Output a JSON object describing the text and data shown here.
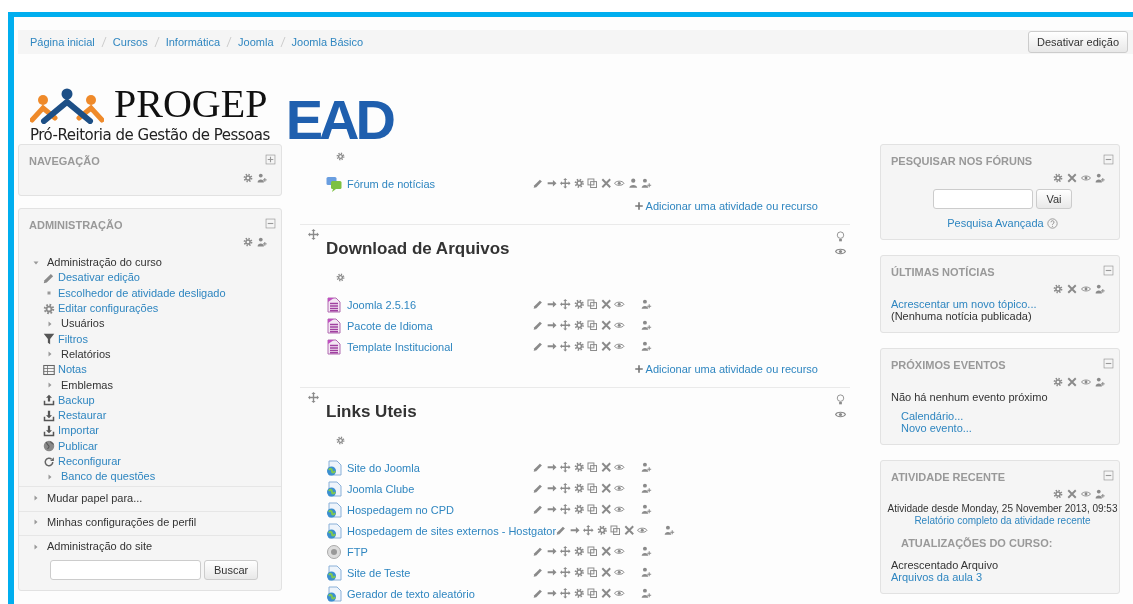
{
  "breadcrumb": [
    "Página inicial",
    "Cursos",
    "Informática",
    "Joomla",
    "Joomla Básico"
  ],
  "edit_button": "Desativar edição",
  "logo": {
    "name": "PROGEP",
    "subtitle": "Pró-Reitoria de Gestão de Pessoas",
    "tag": "EAD"
  },
  "left_blocks": [
    {
      "kind": "navigation",
      "title": "NAVEGAÇÃO",
      "expanded": false,
      "deletable": false
    },
    {
      "kind": "tree",
      "title": "ADMINISTRAÇÃO",
      "expanded": true,
      "deletable": false,
      "button": "Buscar",
      "tree": [
        {
          "kind": "branch",
          "label": "Administração do curso",
          "expanded": true,
          "children": [
            {
              "kind": "link",
              "label": "Desativar edição"
            },
            {
              "kind": "link",
              "label": "Escolhedor de atividade desligado"
            },
            {
              "kind": "link",
              "label": "Editar configurações"
            },
            {
              "kind": "branch",
              "label": "Usuários",
              "expanded": false
            },
            {
              "kind": "link",
              "label": "Filtros"
            },
            {
              "kind": "branch",
              "label": "Relatórios",
              "expanded": false
            },
            {
              "kind": "link",
              "label": "Notas"
            },
            {
              "kind": "branch",
              "label": "Emblemas",
              "expanded": false
            },
            {
              "kind": "link",
              "label": "Backup"
            },
            {
              "kind": "link",
              "label": "Restaurar"
            },
            {
              "kind": "link",
              "label": "Importar"
            },
            {
              "kind": "link",
              "label": "Publicar"
            },
            {
              "kind": "link",
              "label": "Reconfigurar"
            },
            {
              "kind": "branch-link",
              "label": "Banco de questões",
              "expanded": false
            }
          ]
        },
        {
          "kind": "branch",
          "label": "Mudar papel para...",
          "expanded": false
        },
        {
          "kind": "branch",
          "label": "Minhas configurações de perfil",
          "expanded": false
        },
        {
          "kind": "branch",
          "label": "Administração do site",
          "expanded": false
        }
      ]
    }
  ],
  "sections": [
    {
      "activities": [
        {
          "kind": "forum",
          "name": "Fórum de notícias",
          "groups_icon": true
        }
      ],
      "add_link": "Adicionar uma atividade ou recurso"
    },
    {
      "title": "Download de Arquivos",
      "activities": [
        {
          "kind": "file",
          "name": "Joomla 2.5.16",
          "groups_icon": false
        },
        {
          "kind": "file",
          "name": "Pacote de Idioma",
          "groups_icon": false
        },
        {
          "kind": "file",
          "name": "Template Institucional",
          "groups_icon": false
        }
      ],
      "add_link": "Adicionar uma atividade ou recurso"
    },
    {
      "title": "Links Uteis",
      "activities": [
        {
          "kind": "url",
          "name": "Site do Joomla",
          "groups_icon": false
        },
        {
          "kind": "url",
          "name": "Joomla Clube",
          "groups_icon": false
        },
        {
          "kind": "url",
          "name": "Hospedagem no CPD",
          "groups_icon": false
        },
        {
          "kind": "url",
          "name": "Hospedagem de sites externos - Hostgator",
          "groups_icon": false
        },
        {
          "kind": "ftp",
          "name": "FTP",
          "groups_icon": false
        },
        {
          "kind": "url",
          "name": "Site de Teste",
          "groups_icon": false
        },
        {
          "kind": "url",
          "name": "Gerador de texto aleatório",
          "groups_icon": false
        }
      ]
    }
  ],
  "right_blocks": [
    {
      "kind": "search",
      "title": "PESQUISAR NOS FÓRUNS",
      "expanded": true,
      "deletable": true,
      "button": "Vai",
      "link": "Pesquisa Avançada"
    },
    {
      "kind": "news",
      "title": "ÚLTIMAS NOTÍCIAS",
      "expanded": true,
      "deletable": true,
      "link": "Acrescentar um novo tópico...",
      "note": "(Nenhuma notícia publicada)"
    },
    {
      "kind": "events",
      "title": "PRÓXIMOS EVENTOS",
      "expanded": true,
      "deletable": true,
      "note": "Não há nenhum evento próximo",
      "links": [
        "Calendário...",
        "Novo evento..."
      ]
    },
    {
      "kind": "recent",
      "title": "ATIVIDADE RECENTE",
      "expanded": true,
      "deletable": true,
      "since": "Atividade desde Monday, 25 November 2013, 09:53",
      "link": "Relatório completo da atividade recente",
      "subheading": "ATUALIZAÇÕES DO CURSO:",
      "entries": [
        {
          "text": "Acrescentado Arquivo",
          "link": "Arquivos da aula 3"
        }
      ]
    }
  ]
}
